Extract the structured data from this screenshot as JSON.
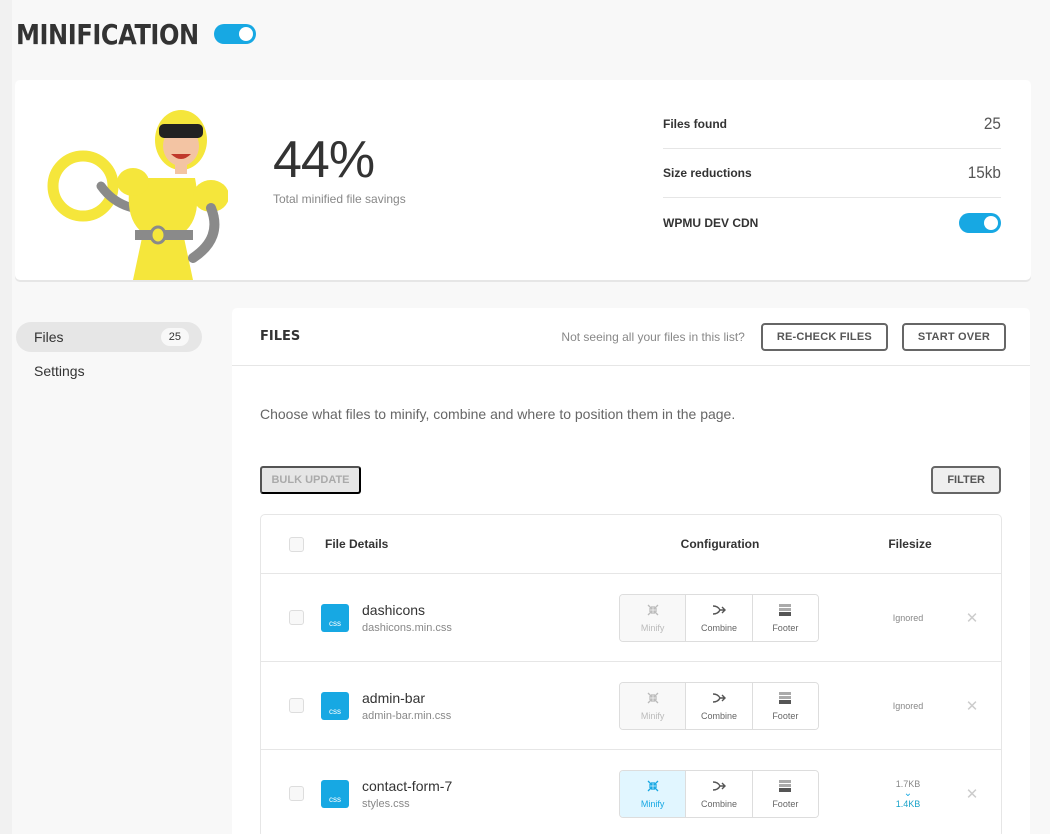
{
  "header": {
    "title": "MINIFICATION",
    "toggle_on": true
  },
  "summary": {
    "percent": "44%",
    "percent_label": "Total minified file savings",
    "stats": [
      {
        "label": "Files found",
        "value": "25"
      },
      {
        "label": "Size reductions",
        "value": "15kb"
      },
      {
        "label": "WPMU DEV CDN",
        "toggle_on": true
      }
    ]
  },
  "sidebar": {
    "items": [
      {
        "label": "Files",
        "count": "25",
        "active": true
      },
      {
        "label": "Settings"
      }
    ]
  },
  "files": {
    "title": "FILES",
    "hint": "Not seeing all your files in this list?",
    "recheck_label": "RE-CHECK FILES",
    "start_over_label": "START OVER",
    "description": "Choose what files to minify, combine and where to position them in the page.",
    "bulk_update_label": "BULK UPDATE",
    "filter_label": "FILTER",
    "columns": {
      "details": "File Details",
      "config": "Configuration",
      "size": "Filesize"
    },
    "config_labels": {
      "minify": "Minify",
      "combine": "Combine",
      "footer": "Footer"
    },
    "rows": [
      {
        "name": "dashicons",
        "path": "dashicons.min.css",
        "type": "css",
        "size_status": "Ignored",
        "minify_state": "disabled"
      },
      {
        "name": "admin-bar",
        "path": "admin-bar.min.css",
        "type": "css",
        "size_status": "Ignored",
        "minify_state": "disabled"
      },
      {
        "name": "contact-form-7",
        "path": "styles.css",
        "type": "css",
        "size_before": "1.7KB",
        "size_after": "1.4KB",
        "minify_state": "active"
      }
    ]
  },
  "colors": {
    "accent": "#17a8e3",
    "hero_yellow": "#f5e63b"
  }
}
